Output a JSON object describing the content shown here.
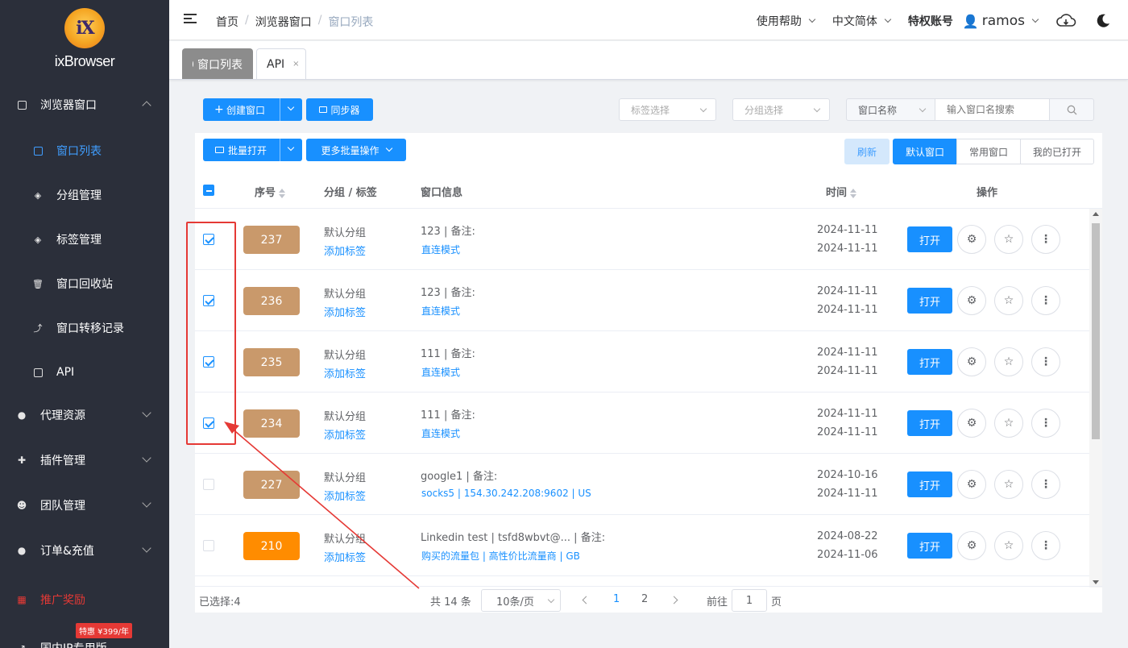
{
  "brand": {
    "logo_letters": "iX",
    "name": "ixBrowser"
  },
  "sidebar": {
    "items": [
      {
        "label": "浏览器窗口",
        "icon": "window-icon"
      },
      {
        "label": "窗口列表",
        "icon": "window-list-icon"
      },
      {
        "label": "分组管理",
        "icon": "layers-icon"
      },
      {
        "label": "标签管理",
        "icon": "tag-layers-icon"
      },
      {
        "label": "窗口回收站",
        "icon": "trash-icon"
      },
      {
        "label": "窗口转移记录",
        "icon": "transfer-icon"
      },
      {
        "label": "API",
        "icon": "api-icon"
      },
      {
        "label": "代理资源",
        "icon": "globe-icon"
      },
      {
        "label": "插件管理",
        "icon": "puzzle-icon"
      },
      {
        "label": "团队管理",
        "icon": "team-icon"
      },
      {
        "label": "订单&充值",
        "icon": "coin-icon"
      },
      {
        "label": "推广奖励",
        "icon": "gift-icon"
      },
      {
        "label": "国内IP专用版",
        "icon": "external-icon"
      }
    ],
    "promo_badge": "特惠 ¥399/年"
  },
  "topbar": {
    "breadcrumb": [
      "首页",
      "浏览器窗口",
      "窗口列表"
    ],
    "breadcrumb_sep": "/",
    "help": "使用帮助",
    "language": "中文简体",
    "account_label": "特权账号",
    "username": "ramos"
  },
  "tabs": [
    {
      "label": "窗口列表"
    },
    {
      "label": "API",
      "close": "×"
    }
  ],
  "toolbar": {
    "create": "创建窗口",
    "sync": "同步器",
    "tag_select": "标签选择",
    "group_select": "分组选择",
    "search_field": "窗口名称",
    "search_placeholder": "输入窗口名搜索"
  },
  "panel": {
    "batch_open": "批量打开",
    "more_batch": "更多批量操作",
    "refresh": "刷新",
    "filters": [
      "默认窗口",
      "常用窗口",
      "我的已打开"
    ]
  },
  "table": {
    "headers": {
      "index": "序号",
      "group": "分组 / 标签",
      "info": "窗口信息",
      "time": "时间",
      "ops": "操作"
    },
    "open_label": "打开",
    "rows": [
      {
        "checked": true,
        "num": "237",
        "color": "#c9996b",
        "group": "默认分组",
        "tag": "添加标签",
        "info": "123 | 备注:",
        "mode": "直连模式",
        "t1": "2024-11-11",
        "t2": "2024-11-11"
      },
      {
        "checked": true,
        "num": "236",
        "color": "#c9996b",
        "group": "默认分组",
        "tag": "添加标签",
        "info": "123 | 备注:",
        "mode": "直连模式",
        "t1": "2024-11-11",
        "t2": "2024-11-11"
      },
      {
        "checked": true,
        "num": "235",
        "color": "#c9996b",
        "group": "默认分组",
        "tag": "添加标签",
        "info": "111 | 备注:",
        "mode": "直连模式",
        "t1": "2024-11-11",
        "t2": "2024-11-11"
      },
      {
        "checked": true,
        "num": "234",
        "color": "#c9996b",
        "group": "默认分组",
        "tag": "添加标签",
        "info": "111 | 备注:",
        "mode": "直连模式",
        "t1": "2024-11-11",
        "t2": "2024-11-11"
      },
      {
        "checked": false,
        "num": "227",
        "color": "#c9996b",
        "group": "默认分组",
        "tag": "添加标签",
        "info": "google1 | 备注:",
        "mode": "socks5 | 154.30.242.208:9602 | US",
        "t1": "2024-10-16",
        "t2": "2024-11-11"
      },
      {
        "checked": false,
        "num": "210",
        "color": "#ff8c00",
        "group": "默认分组",
        "tag": "添加标签",
        "info": "Linkedin test | tsfd8wbvt@... | 备注:",
        "mode": "购买的流量包 | 高性价比流量商 | GB",
        "t1": "2024-08-22",
        "t2": "2024-11-06"
      }
    ]
  },
  "footer": {
    "selected": "已选择:4",
    "total": "共 14 条",
    "page_size": "10条/页",
    "pages": [
      "1",
      "2"
    ],
    "goto_label": "前往",
    "goto_value": "1",
    "page_unit": "页"
  },
  "colors": {
    "primary": "#1890ff",
    "sidebar_bg": "#2b2f3a",
    "annotation_red": "#e53935"
  }
}
